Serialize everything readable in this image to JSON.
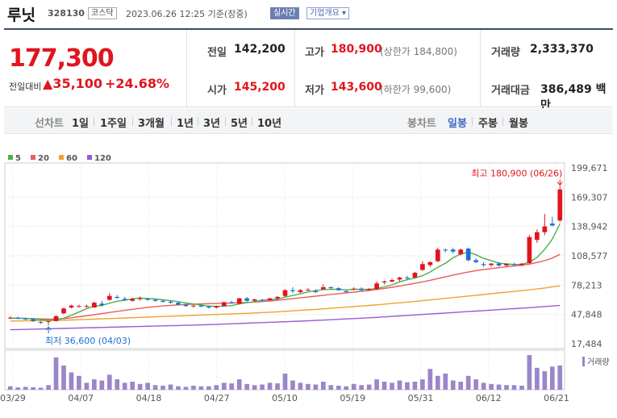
{
  "header": {
    "name": "루닛",
    "code": "328130",
    "market": "코스닥",
    "timestamp": "2023.06.26 12:25 기준(장중)",
    "realtime_label": "실시간",
    "overview_label": "기업개요 ▾"
  },
  "quote": {
    "current_price": "177,300",
    "diff_label": "전일대비",
    "diff_value": "▲35,100",
    "diff_pct": "+24.68%",
    "prev_label": "전일",
    "prev_value": "142,200",
    "open_label": "시가",
    "open_value": "145,200",
    "high_label": "고가",
    "high_value": "180,900",
    "upper_limit": "(상한가 184,800)",
    "low_label": "저가",
    "low_value": "143,600",
    "lower_limit": "(하한가 99,600)",
    "volume_label": "거래량",
    "volume_value": "2,333,370",
    "amount_label": "거래대금",
    "amount_value": "386,489 백만"
  },
  "toolbar": {
    "line_chart_label": "선차트",
    "periods": [
      "1일",
      "1주일",
      "3개월",
      "1년",
      "3년",
      "5년",
      "10년"
    ],
    "candle_label": "봉차트",
    "candle_periods": [
      "일봉",
      "주봉",
      "월봉"
    ],
    "active_candle": "일봉"
  },
  "colors": {
    "up": "#e0151e",
    "down": "#1e6fd0",
    "ma5": "#4caf50",
    "ma20": "#e85c5c",
    "ma60": "#f0a030",
    "ma120": "#9b59d0"
  },
  "chart_data": {
    "type": "candlestick",
    "legend": [
      "5",
      "20",
      "60",
      "120"
    ],
    "y_ticks": [
      "199,671",
      "169,307",
      "138,942",
      "108,577",
      "78,213",
      "47,848",
      "17,484"
    ],
    "ylim": [
      17484,
      199671
    ],
    "x_ticks": [
      "03/29",
      "04/07",
      "04/18",
      "04/27",
      "05/10",
      "05/19",
      "05/31",
      "06/12",
      "06/21"
    ],
    "volume_label": "거래량",
    "high_annotation": "최고 180,900 (06/26)",
    "low_annotation": "최저 36,600 (04/03)",
    "candles": [
      {
        "o": 44000,
        "h": 46000,
        "l": 43000,
        "c": 44500
      },
      {
        "o": 44500,
        "h": 45500,
        "l": 43000,
        "c": 43500
      },
      {
        "o": 43500,
        "h": 44500,
        "l": 42000,
        "c": 43000
      },
      {
        "o": 43000,
        "h": 44000,
        "l": 40000,
        "c": 41000
      },
      {
        "o": 40000,
        "h": 41000,
        "l": 38000,
        "c": 39500
      },
      {
        "o": 40500,
        "h": 41000,
        "l": 36600,
        "c": 41000
      },
      {
        "o": 41000,
        "h": 47000,
        "l": 40500,
        "c": 46000
      },
      {
        "o": 49000,
        "h": 55000,
        "l": 48000,
        "c": 54000
      },
      {
        "o": 55000,
        "h": 58000,
        "l": 54000,
        "c": 57000
      },
      {
        "o": 56000,
        "h": 58000,
        "l": 55000,
        "c": 56500
      },
      {
        "o": 56000,
        "h": 58000,
        "l": 55000,
        "c": 56500
      },
      {
        "o": 55000,
        "h": 61000,
        "l": 55000,
        "c": 60000
      },
      {
        "o": 59000,
        "h": 62000,
        "l": 56000,
        "c": 57500
      },
      {
        "o": 63000,
        "h": 70000,
        "l": 62000,
        "c": 67000
      },
      {
        "o": 66000,
        "h": 68000,
        "l": 64000,
        "c": 65000
      },
      {
        "o": 64000,
        "h": 66000,
        "l": 62000,
        "c": 63000
      },
      {
        "o": 62000,
        "h": 65000,
        "l": 61000,
        "c": 64000
      },
      {
        "o": 64000,
        "h": 66500,
        "l": 62000,
        "c": 64500
      },
      {
        "o": 64000,
        "h": 65000,
        "l": 62000,
        "c": 63000
      },
      {
        "o": 63000,
        "h": 64000,
        "l": 61000,
        "c": 62000
      },
      {
        "o": 62000,
        "h": 63000,
        "l": 60000,
        "c": 61000
      },
      {
        "o": 61000,
        "h": 62000,
        "l": 59000,
        "c": 60000
      },
      {
        "o": 60000,
        "h": 61000,
        "l": 57000,
        "c": 58000
      },
      {
        "o": 58000,
        "h": 59000,
        "l": 56000,
        "c": 56500
      },
      {
        "o": 56500,
        "h": 58000,
        "l": 55000,
        "c": 57000
      },
      {
        "o": 57000,
        "h": 58000,
        "l": 55500,
        "c": 56000
      },
      {
        "o": 56000,
        "h": 57000,
        "l": 54000,
        "c": 55000
      },
      {
        "o": 55000,
        "h": 57000,
        "l": 54000,
        "c": 56500
      },
      {
        "o": 56500,
        "h": 61000,
        "l": 56000,
        "c": 60500
      },
      {
        "o": 60500,
        "h": 62000,
        "l": 59000,
        "c": 60000
      },
      {
        "o": 59000,
        "h": 65000,
        "l": 58500,
        "c": 64500
      },
      {
        "o": 64500,
        "h": 66000,
        "l": 61000,
        "c": 62000
      },
      {
        "o": 62000,
        "h": 64000,
        "l": 61000,
        "c": 63500
      },
      {
        "o": 63000,
        "h": 64000,
        "l": 61500,
        "c": 62500
      },
      {
        "o": 62500,
        "h": 65000,
        "l": 62000,
        "c": 64500
      },
      {
        "o": 64500,
        "h": 67000,
        "l": 63000,
        "c": 66000
      },
      {
        "o": 67000,
        "h": 74000,
        "l": 66000,
        "c": 73000
      },
      {
        "o": 73000,
        "h": 76000,
        "l": 70000,
        "c": 72000
      },
      {
        "o": 71000,
        "h": 74000,
        "l": 70000,
        "c": 73000
      },
      {
        "o": 73000,
        "h": 75000,
        "l": 72000,
        "c": 73500
      },
      {
        "o": 72000,
        "h": 74000,
        "l": 70000,
        "c": 71000
      },
      {
        "o": 74000,
        "h": 79000,
        "l": 73000,
        "c": 76000
      },
      {
        "o": 76000,
        "h": 77000,
        "l": 74000,
        "c": 75500
      },
      {
        "o": 75000,
        "h": 76000,
        "l": 72000,
        "c": 73000
      },
      {
        "o": 72000,
        "h": 73000,
        "l": 70000,
        "c": 71000
      },
      {
        "o": 74000,
        "h": 76000,
        "l": 73000,
        "c": 74500
      },
      {
        "o": 74500,
        "h": 76000,
        "l": 72000,
        "c": 73000
      },
      {
        "o": 73000,
        "h": 75000,
        "l": 72500,
        "c": 74000
      },
      {
        "o": 74000,
        "h": 82000,
        "l": 73500,
        "c": 80000
      },
      {
        "o": 81000,
        "h": 83000,
        "l": 79000,
        "c": 82000
      },
      {
        "o": 82000,
        "h": 85000,
        "l": 81000,
        "c": 83500
      },
      {
        "o": 84000,
        "h": 87000,
        "l": 82000,
        "c": 86000
      },
      {
        "o": 86000,
        "h": 88000,
        "l": 84000,
        "c": 85500
      },
      {
        "o": 86000,
        "h": 92000,
        "l": 85000,
        "c": 91000
      },
      {
        "o": 94000,
        "h": 103000,
        "l": 93000,
        "c": 100000
      },
      {
        "o": 99000,
        "h": 103000,
        "l": 97000,
        "c": 102000
      },
      {
        "o": 103000,
        "h": 117000,
        "l": 102000,
        "c": 115000
      },
      {
        "o": 115000,
        "h": 116000,
        "l": 112000,
        "c": 114500
      },
      {
        "o": 115000,
        "h": 117000,
        "l": 111000,
        "c": 113000
      },
      {
        "o": 110000,
        "h": 116000,
        "l": 109000,
        "c": 115000
      },
      {
        "o": 116000,
        "h": 117000,
        "l": 103000,
        "c": 104000
      },
      {
        "o": 104000,
        "h": 106000,
        "l": 101000,
        "c": 102000
      },
      {
        "o": 100000,
        "h": 102000,
        "l": 97000,
        "c": 99000
      },
      {
        "o": 99000,
        "h": 101000,
        "l": 97000,
        "c": 100500
      },
      {
        "o": 100500,
        "h": 102000,
        "l": 97500,
        "c": 98500
      },
      {
        "o": 98500,
        "h": 101000,
        "l": 97500,
        "c": 100000
      },
      {
        "o": 100000,
        "h": 101500,
        "l": 98000,
        "c": 99000
      },
      {
        "o": 99000,
        "h": 101000,
        "l": 98000,
        "c": 100500
      },
      {
        "o": 101000,
        "h": 130000,
        "l": 100000,
        "c": 128000
      },
      {
        "o": 125000,
        "h": 136000,
        "l": 122000,
        "c": 133000
      },
      {
        "o": 133000,
        "h": 152000,
        "l": 130000,
        "c": 139000
      },
      {
        "o": 142000,
        "h": 149000,
        "l": 139000,
        "c": 140000
      },
      {
        "o": 145200,
        "h": 180900,
        "l": 143600,
        "c": 177300
      }
    ],
    "ma5": [
      44000,
      43900,
      43700,
      43200,
      42400,
      41800,
      42200,
      44000,
      47000,
      50300,
      53900,
      56500,
      57200,
      59500,
      61500,
      62600,
      64000,
      64900,
      64400,
      63900,
      63100,
      62100,
      61200,
      59800,
      58700,
      57600,
      56600,
      56100,
      56500,
      57000,
      58700,
      60000,
      61000,
      62500,
      63200,
      63800,
      65800,
      67500,
      69200,
      71100,
      72500,
      73600,
      74000,
      73900,
      73300,
      73800,
      74000,
      73800,
      74800,
      76400,
      78500,
      81600,
      83800,
      85600,
      88000,
      91800,
      96700,
      101000,
      106500,
      110600,
      112400,
      109600,
      106000,
      103500,
      101000,
      100200,
      99500,
      99700,
      101800,
      107000,
      115200,
      126000,
      142000
    ],
    "ma20": [
      44000,
      43900,
      43700,
      43500,
      43200,
      43000,
      43100,
      43600,
      44400,
      45500,
      46500,
      47600,
      48700,
      49900,
      51000,
      52100,
      53200,
      54200,
      55200,
      56000,
      56700,
      57300,
      57800,
      58200,
      58500,
      58800,
      59000,
      59200,
      59400,
      59600,
      59900,
      60300,
      60700,
      61200,
      61800,
      62500,
      63300,
      64200,
      65000,
      65900,
      66800,
      67700,
      68600,
      69400,
      70200,
      71000,
      71800,
      72700,
      73700,
      74800,
      76000,
      77300,
      78700,
      80100,
      81600,
      83200,
      85000,
      86800,
      88600,
      90300,
      91800,
      93200,
      94400,
      95400,
      96300,
      97200,
      98000,
      98800,
      100000,
      101600,
      103600,
      106200,
      110000
    ],
    "ma60": [
      41000,
      41100,
      41200,
      41300,
      41400,
      41500,
      41700,
      41900,
      42100,
      42400,
      42700,
      43000,
      43300,
      43600,
      43900,
      44200,
      44500,
      44800,
      45100,
      45400,
      45700,
      46000,
      46300,
      46600,
      46900,
      47200,
      47500,
      47800,
      48100,
      48400,
      48700,
      49000,
      49400,
      49800,
      50200,
      50600,
      51100,
      51600,
      52100,
      52600,
      53100,
      53600,
      54200,
      54800,
      55400,
      56000,
      56600,
      57200,
      57800,
      58500,
      59200,
      59900,
      60600,
      61300,
      62100,
      62900,
      63700,
      64500,
      65300,
      66100,
      66900,
      67700,
      68500,
      69300,
      70100,
      70900,
      71700,
      72500,
      73300,
      74200,
      75200,
      76300,
      77600
    ],
    "ma120": [
      32000,
      32200,
      32400,
      32600,
      32800,
      33000,
      33200,
      33400,
      33600,
      33800,
      34000,
      34200,
      34400,
      34600,
      34800,
      35000,
      35200,
      35400,
      35600,
      35800,
      36000,
      36200,
      36400,
      36600,
      36800,
      37000,
      37300,
      37600,
      37900,
      38200,
      38500,
      38800,
      39100,
      39400,
      39700,
      40000,
      40300,
      40600,
      40900,
      41200,
      41600,
      42000,
      42400,
      42800,
      43200,
      43600,
      44000,
      44400,
      44800,
      45300,
      45800,
      46300,
      46800,
      47300,
      47800,
      48300,
      48800,
      49300,
      49800,
      50300,
      50800,
      51300,
      51800,
      52300,
      52800,
      53300,
      53800,
      54300,
      54800,
      55400,
      56000,
      56600,
      57300
    ],
    "volume": [
      30,
      20,
      25,
      22,
      18,
      40,
      280,
      210,
      150,
      120,
      60,
      90,
      80,
      130,
      90,
      60,
      70,
      50,
      60,
      40,
      35,
      45,
      30,
      25,
      35,
      30,
      30,
      40,
      60,
      55,
      90,
      50,
      40,
      45,
      60,
      55,
      140,
      80,
      60,
      50,
      45,
      70,
      40,
      35,
      30,
      50,
      40,
      45,
      90,
      70,
      60,
      80,
      65,
      70,
      90,
      180,
      120,
      140,
      80,
      70,
      120,
      90,
      60,
      50,
      45,
      40,
      40,
      35,
      300,
      190,
      160,
      200,
      210
    ]
  }
}
